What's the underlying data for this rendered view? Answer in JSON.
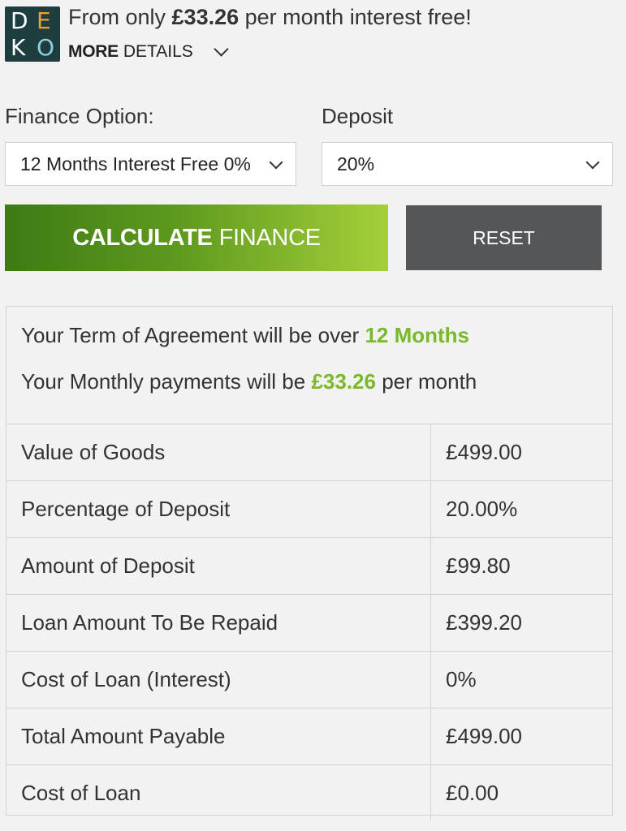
{
  "header": {
    "logo_letters": [
      "D",
      "E",
      "K",
      "O"
    ],
    "headline_prefix": "From only ",
    "headline_amount": "£33.26",
    "headline_suffix": " per month interest free!",
    "more_bold": "MORE",
    "more_rest": "DETAILS"
  },
  "form": {
    "finance_label": "Finance Option:",
    "finance_value": "12 Months Interest Free 0%",
    "deposit_label": "Deposit",
    "deposit_value": "20%"
  },
  "buttons": {
    "calc_bold": "CALCULATE",
    "calc_rest": "FINANCE",
    "reset": "RESET"
  },
  "summary": {
    "term_prefix": "Your Term of Agreement will be over ",
    "term_value": "12 Months",
    "monthly_prefix": "Your Monthly payments will be ",
    "monthly_value": "£33.26",
    "monthly_suffix": " per month"
  },
  "table": {
    "rows": [
      {
        "label": "Value of Goods",
        "value": "£499.00"
      },
      {
        "label": "Percentage of Deposit",
        "value": "20.00%"
      },
      {
        "label": "Amount of Deposit",
        "value": "£99.80"
      },
      {
        "label": "Loan Amount To Be Repaid",
        "value": "£399.20"
      },
      {
        "label": "Cost of Loan (Interest)",
        "value": "0%"
      },
      {
        "label": "Total Amount Payable",
        "value": "£499.00"
      },
      {
        "label": "Cost of Loan",
        "value": "£0.00"
      }
    ]
  },
  "colors": {
    "brand_green": "#7ab929",
    "logo_bg": "#1d3d3f",
    "reset_bg": "#555657"
  }
}
